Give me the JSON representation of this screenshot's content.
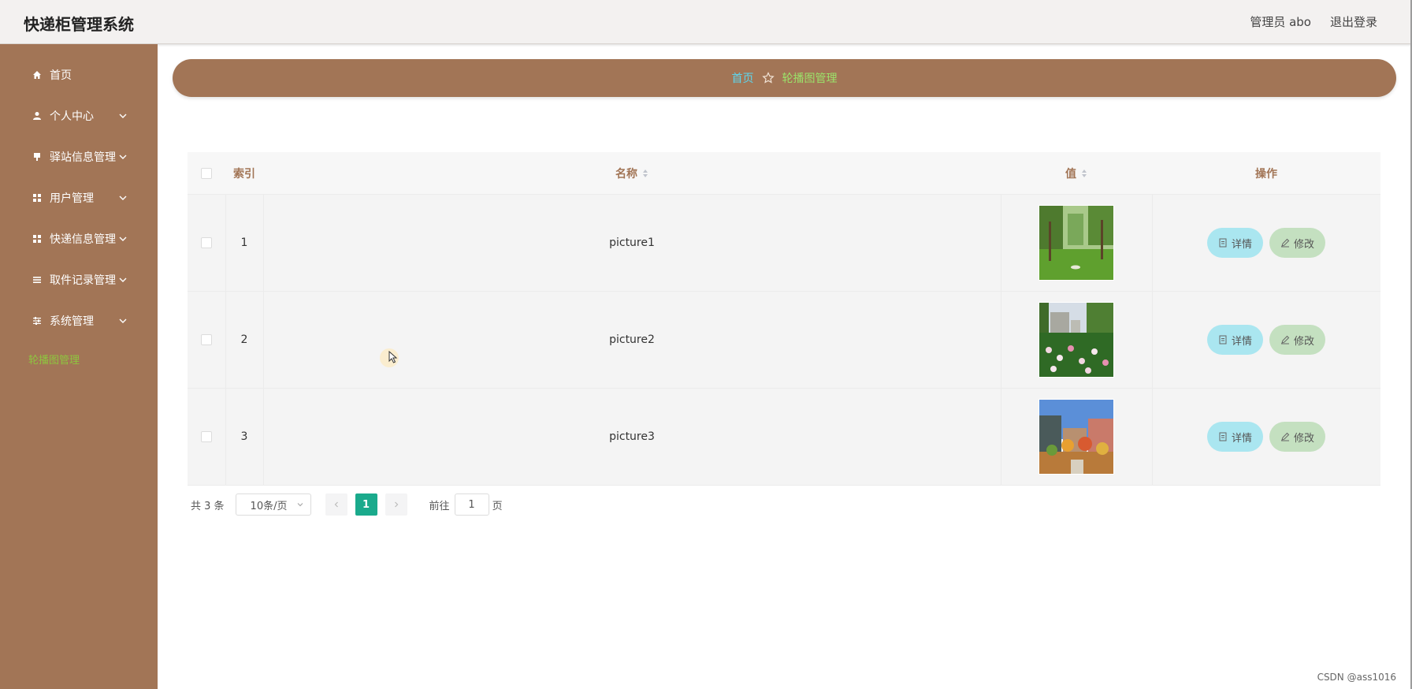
{
  "header": {
    "title": "快递柜管理系统",
    "user_label": "管理员 abo",
    "logout_label": "退出登录"
  },
  "sidebar": {
    "items": [
      {
        "label": "首页",
        "icon": "home-icon"
      },
      {
        "label": "个人中心",
        "icon": "user-icon"
      },
      {
        "label": "驿站信息管理",
        "icon": "pin-icon"
      },
      {
        "label": "用户管理",
        "icon": "grid-icon"
      },
      {
        "label": "快递信息管理",
        "icon": "grid-icon"
      },
      {
        "label": "取件记录管理",
        "icon": "list-icon"
      },
      {
        "label": "系统管理",
        "icon": "sliders-icon"
      }
    ],
    "active_sub": "轮播图管理"
  },
  "breadcrumb": {
    "home": "首页",
    "current": "轮播图管理"
  },
  "table": {
    "headers": {
      "index": "索引",
      "name": "名称",
      "value": "值",
      "actions": "操作"
    },
    "rows": [
      {
        "index": "1",
        "name": "picture1"
      },
      {
        "index": "2",
        "name": "picture2"
      },
      {
        "index": "3",
        "name": "picture3"
      }
    ],
    "detail_label": "详情",
    "edit_label": "修改"
  },
  "pagination": {
    "total": "共 3 条",
    "page_size": "10条/页",
    "current_page": "1",
    "goto_label": "前往",
    "goto_value": "1",
    "page_suffix": "页"
  },
  "watermark": "CSDN @ass1016",
  "colors": {
    "brand": "#a27556",
    "breadcrumb_home": "#5dd6ee",
    "breadcrumb_current": "#9be36a",
    "active_page": "#1aaa8c",
    "detail_button": "#aae6f0",
    "edit_button": "#c4e0c0"
  }
}
